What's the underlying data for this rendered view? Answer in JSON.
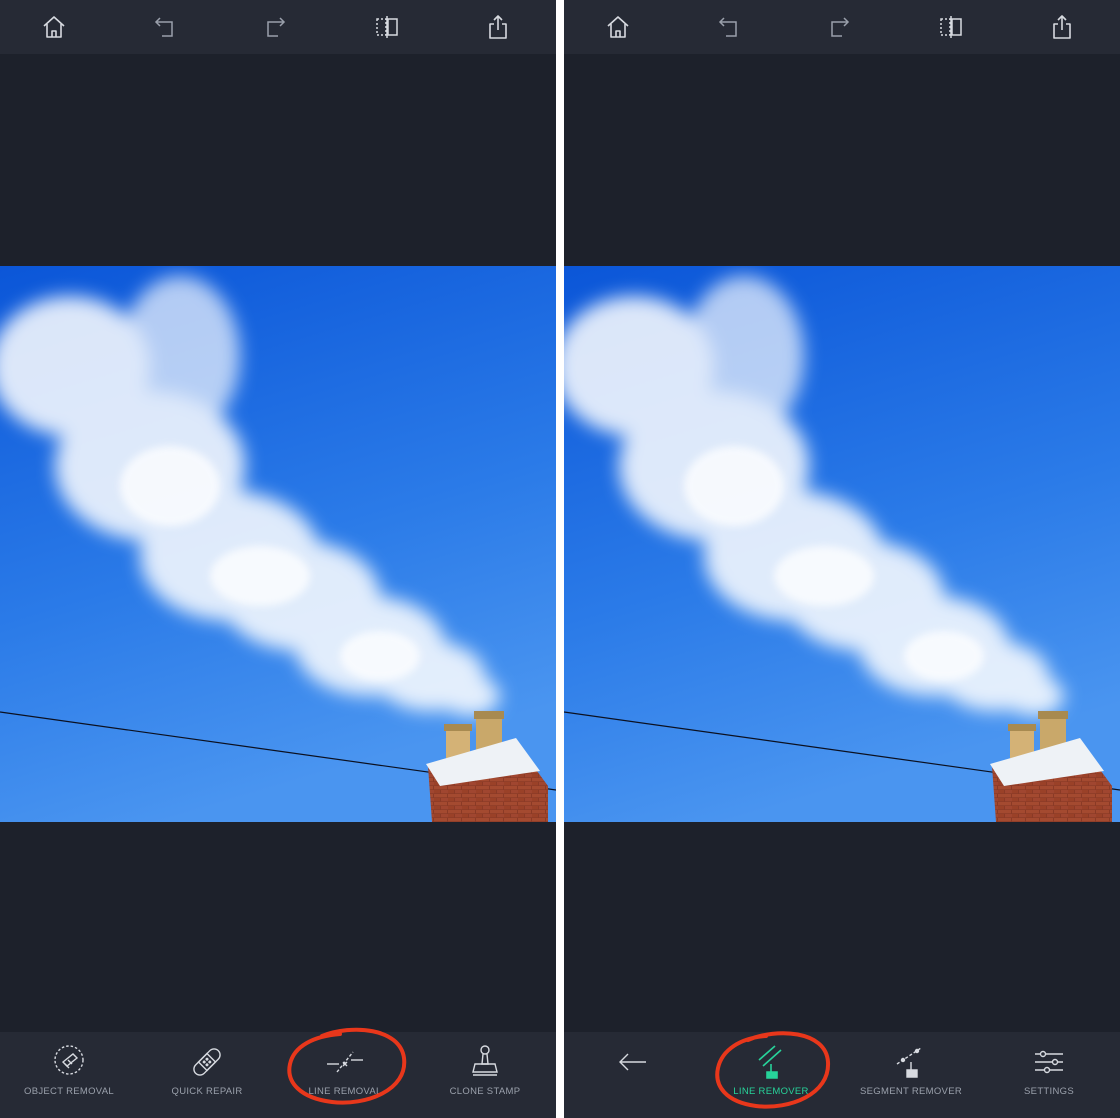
{
  "left_screen": {
    "toolbar": {
      "home_icon": "home-icon",
      "undo_icon": "undo-icon",
      "redo_icon": "redo-icon",
      "compare_icon": "compare-icon",
      "share_icon": "share-icon"
    },
    "tools": [
      {
        "label": "OBJECT REMOVAL",
        "icon": "object-removal-icon"
      },
      {
        "label": "QUICK REPAIR",
        "icon": "bandage-icon"
      },
      {
        "label": "LINE REMOVAL",
        "icon": "line-removal-icon",
        "highlighted": true
      },
      {
        "label": "CLONE STAMP",
        "icon": "stamp-icon"
      }
    ]
  },
  "right_screen": {
    "toolbar": {
      "home_icon": "home-icon",
      "undo_icon": "undo-icon",
      "redo_icon": "redo-icon",
      "compare_icon": "compare-icon",
      "share_icon": "share-icon"
    },
    "back_icon": "back-arrow-icon",
    "tools": [
      {
        "label": "LINE REMOVER",
        "icon": "line-remover-icon",
        "active": true
      },
      {
        "label": "SEGMENT REMOVER",
        "icon": "segment-remover-icon"
      },
      {
        "label": "SETTINGS",
        "icon": "sliders-icon"
      }
    ]
  },
  "colors": {
    "background": "#1d212b",
    "bar": "#262a35",
    "icon": "#d7dae0",
    "label": "#9aa0ab",
    "active": "#27d39a",
    "annotation_circle": "#e8371b",
    "sky_top": "#0a55d6",
    "sky_bottom": "#3e8ef0"
  }
}
